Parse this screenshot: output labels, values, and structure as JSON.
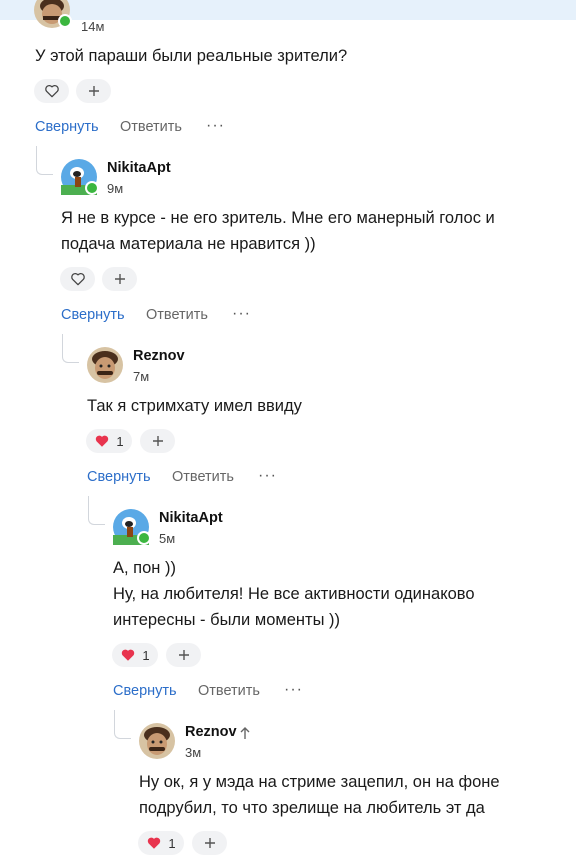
{
  "colors": {
    "link": "#2c6ec9",
    "online": "#3bb63f",
    "heart": "#e8344e",
    "pill": "#f1f2f4",
    "topbar": "#e6f1fb"
  },
  "actions": {
    "collapse": "Свернуть",
    "reply": "Ответить",
    "more": "···"
  },
  "comments": [
    {
      "author": "",
      "time": "14м",
      "text": [
        "У этой параши были реальные зрители?"
      ],
      "likes": "",
      "avatar": "reznov-avatar",
      "online": true
    },
    {
      "author": "NikitaApt",
      "time": "9м",
      "text": [
        "Я не в курсе - не его зритель. Мне его манерный голос и",
        "подача материала не нравится ))"
      ],
      "likes": "",
      "avatar": "nikita-avatar",
      "online": true
    },
    {
      "author": "Reznov",
      "time": "7м",
      "text": [
        "Так я стримхату имел ввиду"
      ],
      "likes": "1",
      "avatar": "reznov-avatar",
      "online": false
    },
    {
      "author": "NikitaApt",
      "time": "5м",
      "text": [
        "А, пон ))",
        "Ну, на любителя! Не все активности одинаково",
        "интересны - были моменты ))"
      ],
      "likes": "1",
      "avatar": "nikita-avatar",
      "online": true
    },
    {
      "author": "Reznov",
      "time": "3м",
      "text": [
        "Ну ок, я у мэда на стриме зацепил, он на фоне",
        "подрубил, то что зрелище на любитель эт да"
      ],
      "likes": "1",
      "avatar": "reznov-avatar",
      "online": false
    }
  ]
}
